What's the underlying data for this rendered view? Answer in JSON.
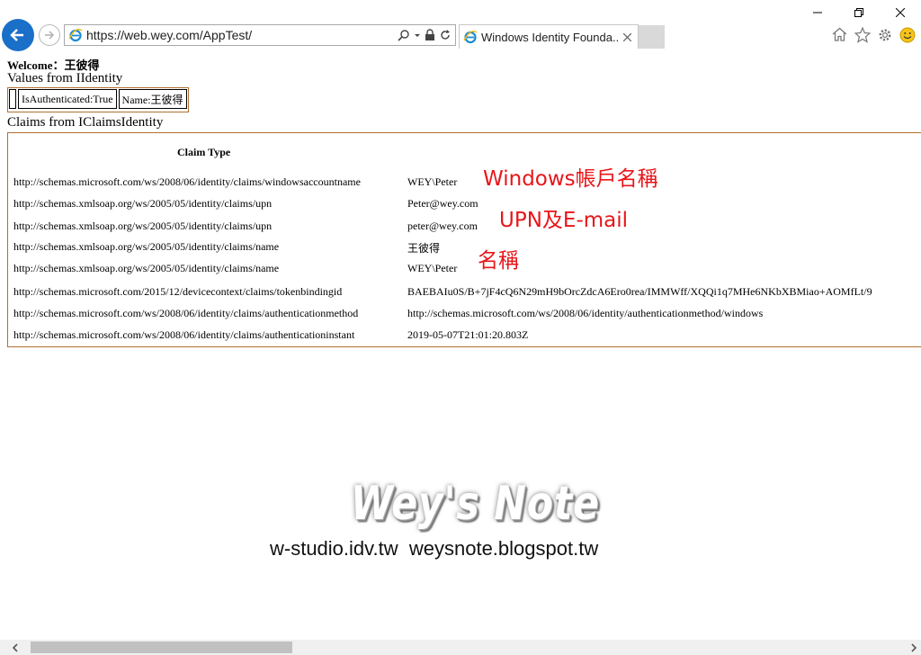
{
  "browser": {
    "url": "https://web.wey.com/AppTest/",
    "tab_title": "Windows Identity Founda...",
    "window_controls": [
      "minimize-icon",
      "restore-icon",
      "close-icon"
    ],
    "toolbar_icons": [
      "home-icon",
      "favorites-star-icon",
      "settings-gear-icon",
      "feedback-smiley-icon"
    ],
    "accent_color": "#1a6fc8"
  },
  "page": {
    "welcome": "Welcome：王彼得",
    "identity_heading": "Values from IIdentity",
    "identity_cells": [
      "",
      "IsAuthenticated:True",
      "Name:王彼得"
    ],
    "claims_heading": "Claims from IClaimsIdentity",
    "claims_header": "Claim Type",
    "claims": [
      {
        "type": "http://schemas.microsoft.com/ws/2008/06/identity/claims/windowsaccountname",
        "value": "WEY\\Peter"
      },
      {
        "type": "http://schemas.xmlsoap.org/ws/2005/05/identity/claims/upn",
        "value": "Peter@wey.com"
      },
      {
        "type": "http://schemas.xmlsoap.org/ws/2005/05/identity/claims/upn",
        "value": "peter@wey.com"
      },
      {
        "type": "http://schemas.xmlsoap.org/ws/2005/05/identity/claims/name",
        "value": "王彼得"
      },
      {
        "type": "http://schemas.xmlsoap.org/ws/2005/05/identity/claims/name",
        "value": "WEY\\Peter"
      },
      {
        "type": "http://schemas.microsoft.com/2015/12/devicecontext/claims/tokenbindingid",
        "value": "BAEBAIu0S/B+7jF4cQ6N29mH9bOrcZdcA6Ero0rea/IMMWff/XQQi1q7MHe6NKbXBMiao+AOMfLt/9"
      },
      {
        "type": "http://schemas.microsoft.com/ws/2008/06/identity/claims/authenticationmethod",
        "value": "http://schemas.microsoft.com/ws/2008/06/identity/authenticationmethod/windows"
      },
      {
        "type": "http://schemas.microsoft.com/ws/2008/06/identity/claims/authenticationinstant",
        "value": "2019-05-07T21:01:20.803Z"
      }
    ]
  },
  "annotations": {
    "windows_account": "Windows帳戶名稱",
    "upn_email": "UPN及E-mail",
    "name": "名稱",
    "color": "#e8161a"
  },
  "watermark": {
    "title": "Wey's Note",
    "subtitle": "w-studio.idv.tw  weysnote.blogspot.tw"
  }
}
